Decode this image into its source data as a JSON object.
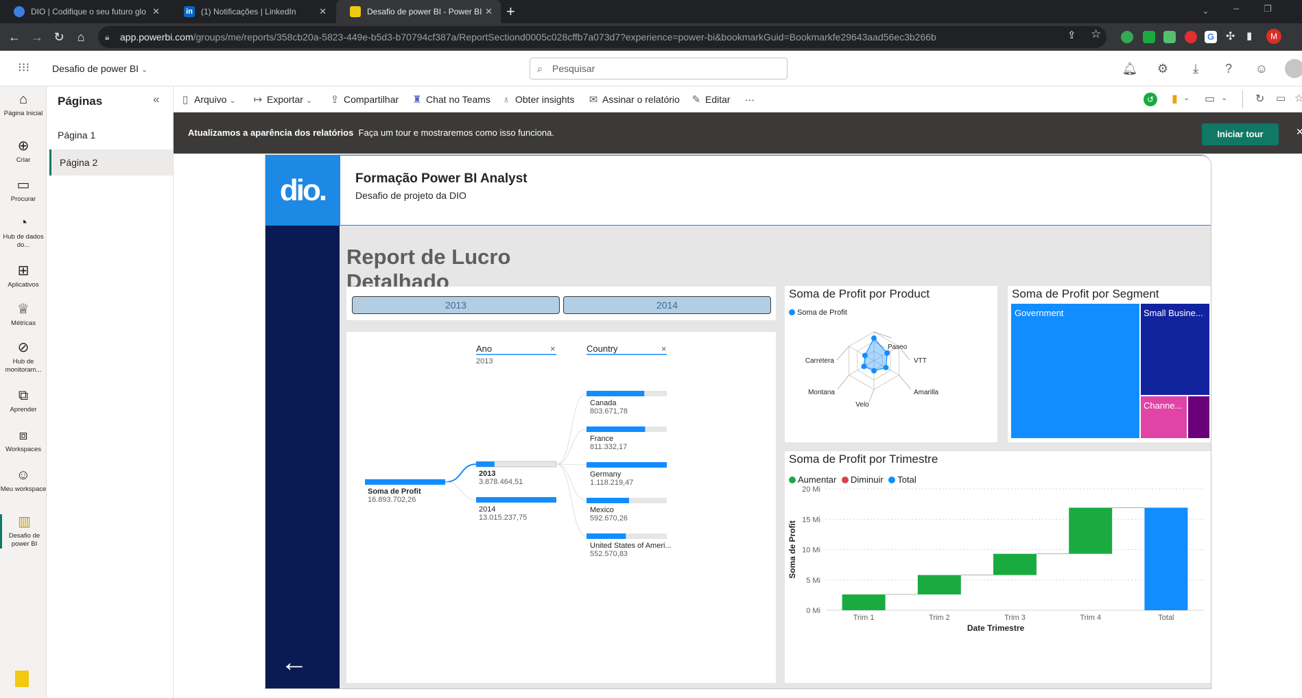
{
  "browser": {
    "tabs": [
      {
        "title": "DIO | Codifique o seu futuro glo",
        "favicon_color": "#3d7fe0"
      },
      {
        "title": "(1) Notificações | LinkedIn",
        "favicon_color": "#0a66c2",
        "favicon_text": "in"
      },
      {
        "title": "Desafio de power BI - Power BI",
        "favicon_color": "#f2c811"
      }
    ],
    "new_tab": "+",
    "url_host": "app.powerbi.com",
    "url_path": "/groups/me/reports/358cb20a-5823-449e-b5d3-b70794cf387a/ReportSectiond0005c028cffb7a073d7?experience=power-bi&bookmarkGuid=Bookmarkfe29643aad56ec3b266b"
  },
  "pbi_header": {
    "report_name": "Desafio de power BI",
    "search_placeholder": "Pesquisar",
    "avatar_letter": "M"
  },
  "left_nav": [
    {
      "label": "Página Inicial",
      "icon": "home-icon",
      "glyph": "⌂"
    },
    {
      "label": "Criar",
      "icon": "plus-circle-icon",
      "glyph": "⊕"
    },
    {
      "label": "Procurar",
      "icon": "folder-icon",
      "glyph": "▭"
    },
    {
      "label": "Hub de dados do...",
      "icon": "data-hub-icon",
      "glyph": "◔"
    },
    {
      "label": "Aplicativos",
      "icon": "apps-icon",
      "glyph": "⊞"
    },
    {
      "label": "Métricas",
      "icon": "trophy-icon",
      "glyph": "♕"
    },
    {
      "label": "Hub de monitoram...",
      "icon": "monitor-icon",
      "glyph": "⊘"
    },
    {
      "label": "Aprender",
      "icon": "book-icon",
      "glyph": "⧉"
    },
    {
      "label": "Workspaces",
      "icon": "workspaces-icon",
      "glyph": "⧈"
    },
    {
      "label": "Meu workspace",
      "icon": "person-icon",
      "glyph": "☺"
    },
    {
      "label": "Desafio de power BI",
      "icon": "report-icon",
      "glyph": "▥"
    }
  ],
  "pages_pane": {
    "title": "Páginas",
    "pages": [
      "Página 1",
      "Página 2"
    ]
  },
  "toolbar": {
    "items": [
      {
        "label": "Arquivo",
        "icon": "file-icon",
        "glyph": "▯",
        "dropdown": true
      },
      {
        "label": "Exportar",
        "icon": "export-icon",
        "glyph": "↦",
        "dropdown": true
      },
      {
        "label": "Compartilhar",
        "icon": "share-icon",
        "glyph": "⇪",
        "dropdown": false
      },
      {
        "label": "Chat no Teams",
        "icon": "teams-icon",
        "glyph": "♜",
        "dropdown": false
      },
      {
        "label": "Obter insights",
        "icon": "lightbulb-icon",
        "glyph": "♁",
        "dropdown": false
      },
      {
        "label": "Assinar o relatório",
        "icon": "subscribe-icon",
        "glyph": "✉",
        "dropdown": false
      },
      {
        "label": "Editar",
        "icon": "pencil-icon",
        "glyph": "✎",
        "dropdown": false
      }
    ],
    "more": "···"
  },
  "banner": {
    "bold": "Atualizamos a aparência dos relatórios",
    "text": "Faça um tour e mostraremos como isso funciona.",
    "button": "Iniciar tour"
  },
  "report": {
    "logo_text": "dio.",
    "header_title": "Formação Power BI Analyst",
    "header_subtitle": "Desafio de projeto da DIO",
    "big_title": "Report de Lucro Detalhado",
    "slicer": [
      "2013",
      "2014"
    ],
    "decomp": {
      "level1_header": "Ano",
      "level1_filter": "2013",
      "level2_header": "Country",
      "root": {
        "label": "Soma de Profit",
        "value": "16.893.702,26"
      },
      "years": [
        {
          "label": "2013",
          "value": "3.878.464,51",
          "fraction": 0.23,
          "selected": true
        },
        {
          "label": "2014",
          "value": "13.015.237,75",
          "fraction": 1.0,
          "selected": false
        }
      ],
      "countries": [
        {
          "label": "Canada",
          "value": "803.671,78",
          "fraction": 0.72
        },
        {
          "label": "France",
          "value": "811.332,17",
          "fraction": 0.73
        },
        {
          "label": "Germany",
          "value": "1.118.219,47",
          "fraction": 1.0
        },
        {
          "label": "Mexico",
          "value": "592.670,26",
          "fraction": 0.53
        },
        {
          "label": "United States of Ameri...",
          "value": "552.570,83",
          "fraction": 0.49
        }
      ]
    },
    "radar": {
      "title": "Soma de Profit por Product",
      "legend": "Soma de Profit",
      "axes": [
        "Paseo",
        "VTT",
        "Amarilla",
        "Velo",
        "Montana",
        "Carretera"
      ],
      "values": [
        0.78,
        0.53,
        0.48,
        0.35,
        0.4,
        0.36
      ],
      "color": "#118dff"
    },
    "treemap": {
      "title": "Soma de Profit por Segment",
      "items": [
        {
          "label": "Government",
          "color": "#118dff"
        },
        {
          "label": "Small Busine...",
          "color": "#12239e"
        },
        {
          "label": "Channe...",
          "color": "#e044a7"
        },
        {
          "label": "",
          "color": "#6b007b"
        }
      ]
    },
    "waterfall": {
      "title": "Soma de Profit por Trimestre",
      "legend": [
        {
          "label": "Aumentar",
          "color": "#1aab40"
        },
        {
          "label": "Diminuir",
          "color": "#d64550"
        },
        {
          "label": "Total",
          "color": "#118dff"
        }
      ]
    }
  },
  "chart_data": {
    "type": "bar",
    "title": "Soma de Profit por Trimestre",
    "xlabel": "Date Trimestre",
    "ylabel": "Soma de Profit",
    "categories": [
      "Trim 1",
      "Trim 2",
      "Trim 3",
      "Trim 4",
      "Total"
    ],
    "series": [
      {
        "name": "Aumentar",
        "values": [
          2.6,
          3.2,
          3.5,
          7.6,
          null
        ]
      },
      {
        "name": "Total",
        "values": [
          null,
          null,
          null,
          null,
          16.9
        ]
      }
    ],
    "waterfall_start": [
      0,
      2.6,
      5.8,
      9.3,
      0
    ],
    "yticks": [
      "0 Mi",
      "5 Mi",
      "10 Mi",
      "15 Mi",
      "20 Mi"
    ],
    "ylim": [
      0,
      20
    ],
    "unit": "Mi",
    "grid": true
  }
}
